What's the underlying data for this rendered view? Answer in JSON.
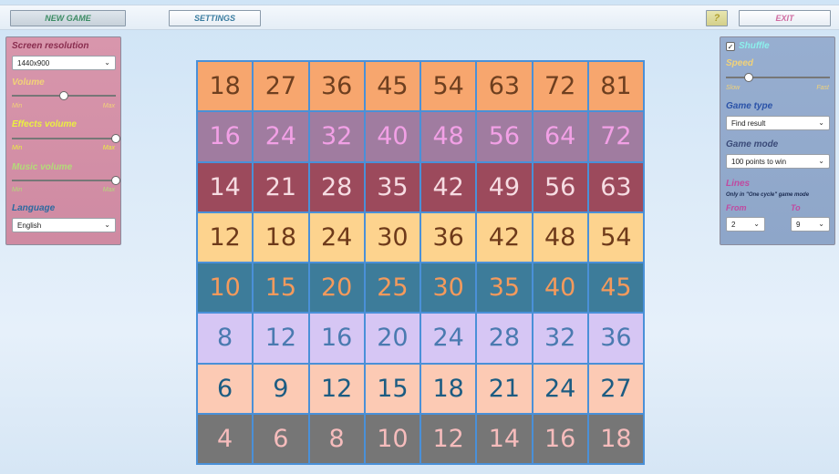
{
  "toolbar": {
    "new_game": "NEW GAME",
    "settings": "SETTINGS",
    "help": "?",
    "exit": "EXIT"
  },
  "left_panel": {
    "resolution_label": "Screen resolution",
    "resolution_value": "1440x900",
    "volume_label": "Volume",
    "volume_level": 0.5,
    "effects_label": "Effects volume",
    "effects_level": 1.0,
    "music_label": "Music volume",
    "music_level": 1.0,
    "min": "Min",
    "max": "Max",
    "language_label": "Language",
    "language_value": "English"
  },
  "right_panel": {
    "shuffle_label": "Shuffle",
    "shuffle_checked": true,
    "speed_label": "Speed",
    "speed_level": 0.22,
    "slow": "Slow",
    "fast": "Fast",
    "game_type_label": "Game type",
    "game_type_value": "Find result",
    "game_mode_label": "Game mode",
    "game_mode_value": "100 points to win",
    "lines_label": "Lines",
    "lines_note": "Only in \"One cycle\" game mode",
    "from_label": "From",
    "to_label": "To",
    "from_value": "2",
    "to_value": "9"
  },
  "grid": {
    "rows": [
      {
        "bg": "#f7a66e",
        "fg": "#6e3f1f",
        "values": [
          18,
          27,
          36,
          45,
          54,
          63,
          72,
          81
        ]
      },
      {
        "bg": "#a07ca0",
        "fg": "#f2a0e6",
        "values": [
          16,
          24,
          32,
          40,
          48,
          56,
          64,
          72
        ]
      },
      {
        "bg": "#9c4a5c",
        "fg": "#f6dce2",
        "values": [
          14,
          21,
          28,
          35,
          42,
          49,
          56,
          63
        ]
      },
      {
        "bg": "#fdd38e",
        "fg": "#6e3a1a",
        "values": [
          12,
          18,
          24,
          30,
          36,
          42,
          48,
          54
        ]
      },
      {
        "bg": "#3d7c9a",
        "fg": "#f49a5c",
        "values": [
          10,
          15,
          20,
          25,
          30,
          35,
          40,
          45
        ]
      },
      {
        "bg": "#d6c6f4",
        "fg": "#4a7ab0",
        "values": [
          8,
          12,
          16,
          20,
          24,
          28,
          32,
          36
        ]
      },
      {
        "bg": "#fccab4",
        "fg": "#1c5c82",
        "values": [
          6,
          9,
          12,
          15,
          18,
          21,
          24,
          27
        ]
      },
      {
        "bg": "#767676",
        "fg": "#f6bcbc",
        "values": [
          4,
          6,
          8,
          10,
          12,
          14,
          16,
          18
        ]
      }
    ]
  }
}
